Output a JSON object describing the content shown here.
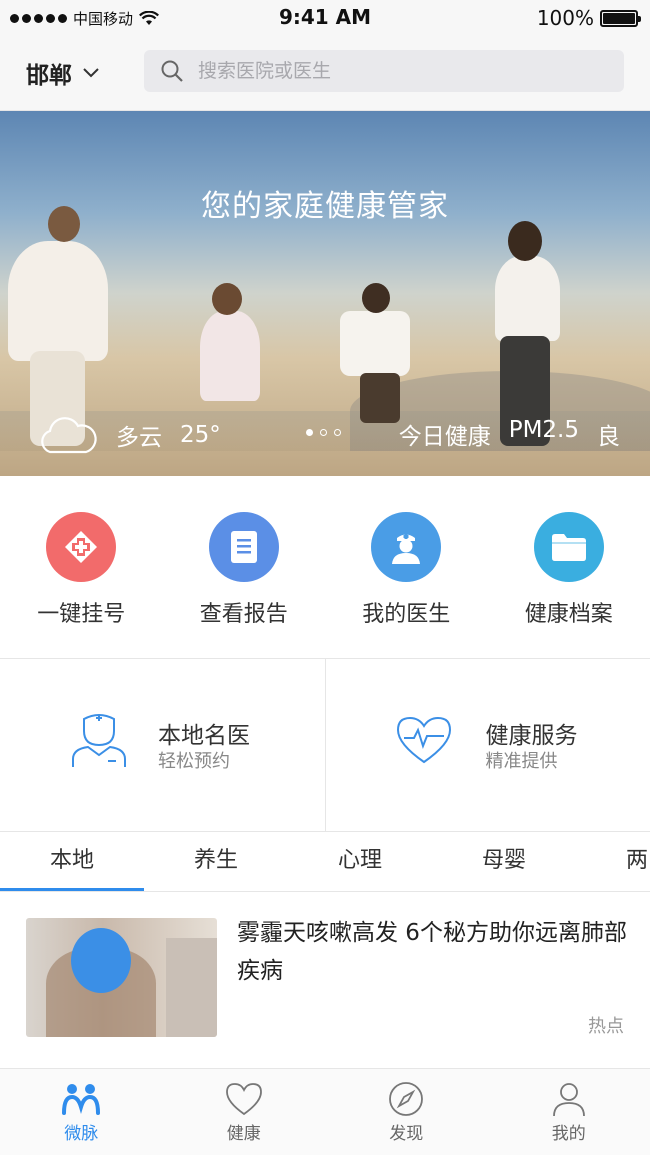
{
  "status_bar": {
    "carrier": "中国移动",
    "time": "9:41 AM",
    "battery": "100%"
  },
  "header": {
    "city": "邯郸",
    "search_placeholder": "搜索医院或医生"
  },
  "banner": {
    "title": "您的家庭健康管家",
    "weather": "多云",
    "temperature": "25°",
    "health_label": "今日健康",
    "pm_label": "PM2.5",
    "air_quality": "良",
    "slide_count": 3,
    "active_slide": 1
  },
  "quick_actions": [
    {
      "label": "一键挂号",
      "icon": "hospital-cross-icon",
      "color": "#f26b6b"
    },
    {
      "label": "查看报告",
      "icon": "report-icon",
      "color": "#5b8fe6"
    },
    {
      "label": "我的医生",
      "icon": "doctor-icon",
      "color": "#4a9de6"
    },
    {
      "label": "健康档案",
      "icon": "folder-icon",
      "color": "#3aaee0"
    }
  ],
  "features": [
    {
      "title": "本地名医",
      "subtitle": "轻松预约",
      "icon": "doctor-outline-icon"
    },
    {
      "title": "健康服务",
      "subtitle": "精准提供",
      "icon": "heartbeat-icon"
    }
  ],
  "tabs": [
    "本地",
    "养生",
    "心理",
    "母婴",
    "两"
  ],
  "active_tab": 0,
  "article": {
    "title": "雾霾天咳嗽高发 6个秘方助你远离肺部疾病",
    "tag": "热点"
  },
  "tabbar": [
    {
      "label": "微脉",
      "icon": "weimai-icon"
    },
    {
      "label": "健康",
      "icon": "heart-icon"
    },
    {
      "label": "发现",
      "icon": "compass-icon"
    },
    {
      "label": "我的",
      "icon": "person-icon"
    }
  ],
  "active_tabbar": 0,
  "accent_color": "#2f8cec"
}
